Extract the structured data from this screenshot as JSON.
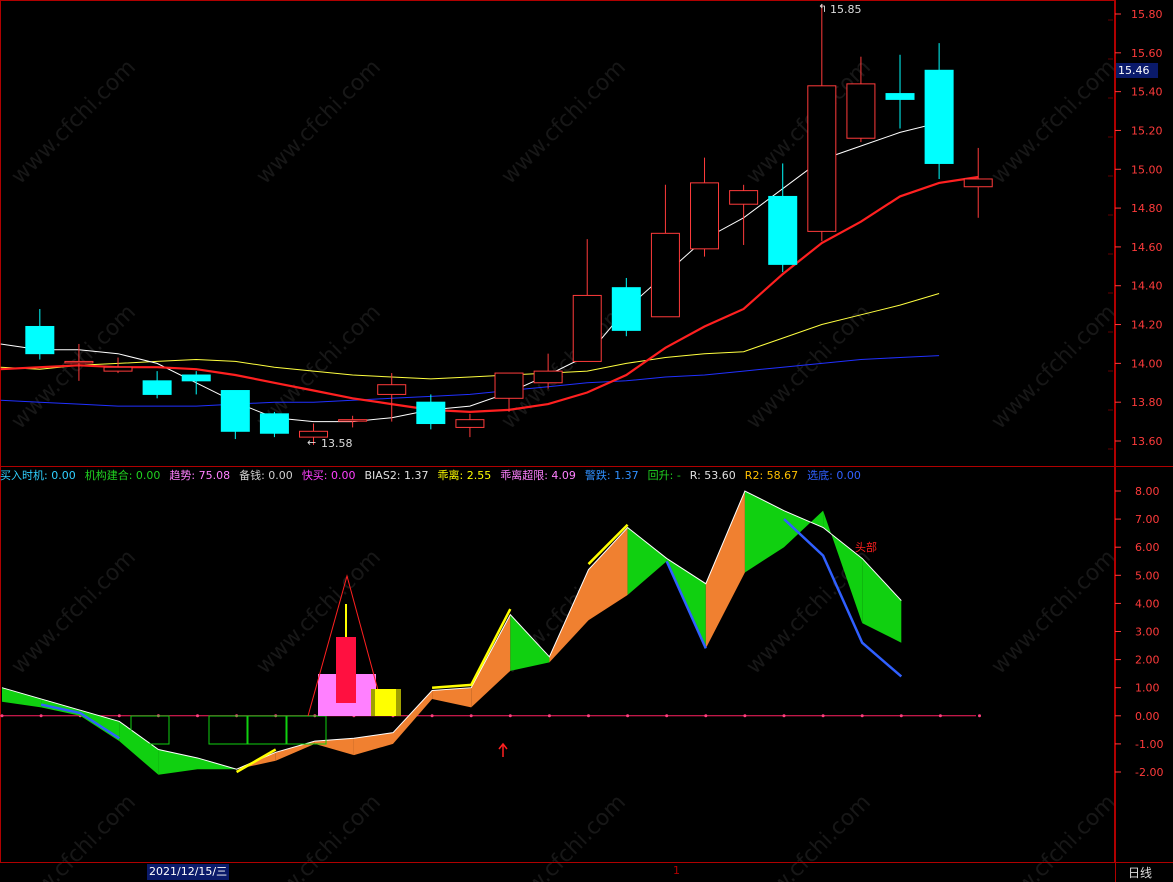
{
  "colors": {
    "up": "#ff3b3b",
    "down": "#00ffff",
    "ma5": "#ffffff",
    "ma10": "#ff2020",
    "ma20": "#ffff40",
    "ma60": "#2030ff",
    "frame": "#b00000",
    "tick": "#ff3b3b"
  },
  "watermark": "www.cfchi.com",
  "price_panel": {
    "current_price_label": "15.46",
    "high_annotation": "15.85",
    "low_annotation": "13.58",
    "axis_ticks": [
      "15.80",
      "15.60",
      "15.40",
      "15.20",
      "15.00",
      "14.80",
      "14.60",
      "14.40",
      "14.20",
      "14.00",
      "13.80",
      "13.60"
    ]
  },
  "indicator_legend": [
    {
      "label": "买入时机:",
      "value": "0.00",
      "color": "#30d0ff"
    },
    {
      "label": "机构建合:",
      "value": "0.00",
      "color": "#20d020"
    },
    {
      "label": "趋势:",
      "value": "75.08",
      "color": "#ff80ff"
    },
    {
      "label": "备钱:",
      "value": "0.00",
      "color": "#d0d0d0"
    },
    {
      "label": "快买:",
      "value": "0.00",
      "color": "#ff40ff"
    },
    {
      "label": "BIAS2:",
      "value": "1.37",
      "color": "#e0e0e0"
    },
    {
      "label": "乖离:",
      "value": "2.55",
      "color": "#ffff00"
    },
    {
      "label": "乖离超限:",
      "value": "4.09",
      "color": "#ff80ff"
    },
    {
      "label": "警跌:",
      "value": "1.37",
      "color": "#3090ff"
    },
    {
      "label": "回升:",
      "value": "-",
      "color": "#20d020"
    },
    {
      "label": "R:",
      "value": "53.60",
      "color": "#e0e0e0"
    },
    {
      "label": "R2:",
      "value": "58.67",
      "color": "#ffc000"
    },
    {
      "label": "选底:",
      "value": "0.00",
      "color": "#3060ff"
    }
  ],
  "indicator_panel": {
    "axis_ticks": [
      "8.00",
      "7.00",
      "6.00",
      "5.00",
      "4.00",
      "3.00",
      "2.00",
      "1.00",
      "0.00",
      "-1.00",
      "-2.00"
    ],
    "top_text": "头部"
  },
  "bottom_bar": {
    "date_label": "2021/12/15/三",
    "marker": "1",
    "period_label": "日线"
  },
  "chart_data": [
    {
      "type": "candlestick",
      "ylim": [
        13.48,
        15.88
      ],
      "candles": [
        {
          "o": 14.19,
          "c": 14.19,
          "h": 14.19,
          "l": 14.19
        },
        {
          "o": 14.19,
          "c": 14.05,
          "h": 14.28,
          "l": 14.02
        },
        {
          "o": 14.01,
          "c": 14.01,
          "h": 14.1,
          "l": 13.91
        },
        {
          "o": 13.96,
          "c": 13.98,
          "h": 14.03,
          "l": 13.95
        },
        {
          "o": 13.91,
          "c": 13.84,
          "h": 13.96,
          "l": 13.82
        },
        {
          "o": 13.94,
          "c": 13.91,
          "h": 13.96,
          "l": 13.84
        },
        {
          "o": 13.86,
          "c": 13.65,
          "h": 13.86,
          "l": 13.61
        },
        {
          "o": 13.74,
          "c": 13.64,
          "h": 13.75,
          "l": 13.62
        },
        {
          "o": 13.62,
          "c": 13.65,
          "h": 13.69,
          "l": 13.58
        },
        {
          "o": 13.71,
          "c": 13.71,
          "h": 13.73,
          "l": 13.67
        },
        {
          "o": 13.84,
          "c": 13.89,
          "h": 13.95,
          "l": 13.7
        },
        {
          "o": 13.8,
          "c": 13.69,
          "h": 13.84,
          "l": 13.66
        },
        {
          "o": 13.67,
          "c": 13.71,
          "h": 13.74,
          "l": 13.62
        },
        {
          "o": 13.82,
          "c": 13.95,
          "h": 13.95,
          "l": 13.75
        },
        {
          "o": 13.9,
          "c": 13.96,
          "h": 14.05,
          "l": 13.87
        },
        {
          "o": 14.01,
          "c": 14.35,
          "h": 14.64,
          "l": 14.01
        },
        {
          "o": 14.39,
          "c": 14.17,
          "h": 14.44,
          "l": 14.14
        },
        {
          "o": 14.24,
          "c": 14.67,
          "h": 14.92,
          "l": 14.24
        },
        {
          "o": 14.59,
          "c": 14.93,
          "h": 15.06,
          "l": 14.55
        },
        {
          "o": 14.82,
          "c": 14.89,
          "h": 14.92,
          "l": 14.61
        },
        {
          "o": 14.86,
          "c": 14.51,
          "h": 15.03,
          "l": 14.47
        },
        {
          "o": 14.68,
          "c": 15.43,
          "h": 15.85,
          "l": 14.63
        },
        {
          "o": 15.16,
          "c": 15.44,
          "h": 15.58,
          "l": 15.14
        },
        {
          "o": 15.39,
          "c": 15.36,
          "h": 15.59,
          "l": 15.21
        },
        {
          "o": 15.51,
          "c": 15.03,
          "h": 15.65,
          "l": 14.95
        },
        {
          "o": 14.91,
          "c": 14.95,
          "h": 15.11,
          "l": 14.75
        }
      ],
      "ma5": [
        14.1,
        14.07,
        14.07,
        14.05,
        14.0,
        13.9,
        13.8,
        13.72,
        13.7,
        13.7,
        13.72,
        13.76,
        13.78,
        13.85,
        13.94,
        14.04,
        14.28,
        14.46,
        14.64,
        14.75,
        14.9,
        15.05,
        15.12,
        15.19,
        15.24
      ],
      "ma10": [
        13.97,
        13.98,
        13.99,
        13.98,
        13.98,
        13.97,
        13.94,
        13.9,
        13.86,
        13.82,
        13.79,
        13.76,
        13.75,
        13.76,
        13.79,
        13.85,
        13.94,
        14.08,
        14.19,
        14.28,
        14.46,
        14.62,
        14.73,
        14.86,
        14.93,
        14.96
      ],
      "ma20": [
        13.98,
        13.97,
        13.99,
        14.0,
        14.01,
        14.02,
        14.01,
        13.98,
        13.96,
        13.94,
        13.93,
        13.92,
        13.93,
        13.94,
        13.95,
        13.96,
        14.0,
        14.03,
        14.05,
        14.06,
        14.13,
        14.2,
        14.25,
        14.3,
        14.36
      ],
      "ma60": [
        13.81,
        13.8,
        13.79,
        13.78,
        13.78,
        13.78,
        13.79,
        13.8,
        13.8,
        13.81,
        13.82,
        13.83,
        13.84,
        13.86,
        13.88,
        13.9,
        13.91,
        13.93,
        13.94,
        13.96,
        13.98,
        14.0,
        14.02,
        14.03,
        14.04
      ]
    },
    {
      "type": "area",
      "ylim": [
        -2.5,
        8.5
      ],
      "upper": [
        1.0,
        0.6,
        0.2,
        -0.2,
        -1.2,
        -1.5,
        -1.9,
        -1.3,
        -0.9,
        -0.8,
        -0.6,
        0.9,
        1.0,
        3.6,
        2.1,
        5.2,
        6.7,
        5.6,
        4.7,
        8.0,
        7.3,
        6.7,
        5.6,
        4.1
      ],
      "lower": [
        0.5,
        0.3,
        0.0,
        -0.9,
        -2.1,
        -1.9,
        -1.9,
        -1.6,
        -1.0,
        -1.4,
        -1.0,
        0.6,
        0.3,
        1.6,
        1.9,
        3.4,
        4.3,
        5.5,
        2.4,
        5.1,
        6.0,
        7.3,
        3.3,
        2.6
      ],
      "yellow": [
        null,
        null,
        null,
        null,
        null,
        null,
        -2.0,
        -1.2,
        null,
        null,
        null,
        1.0,
        1.1,
        3.8,
        null,
        5.4,
        6.8,
        null,
        null,
        8.1,
        null,
        null,
        null,
        null
      ],
      "blue": [
        null,
        0.4,
        0.1,
        -0.8,
        null,
        null,
        null,
        null,
        null,
        null,
        null,
        null,
        null,
        null,
        null,
        null,
        null,
        5.5,
        2.4,
        null,
        7.0,
        5.7,
        2.6,
        1.4
      ]
    }
  ]
}
